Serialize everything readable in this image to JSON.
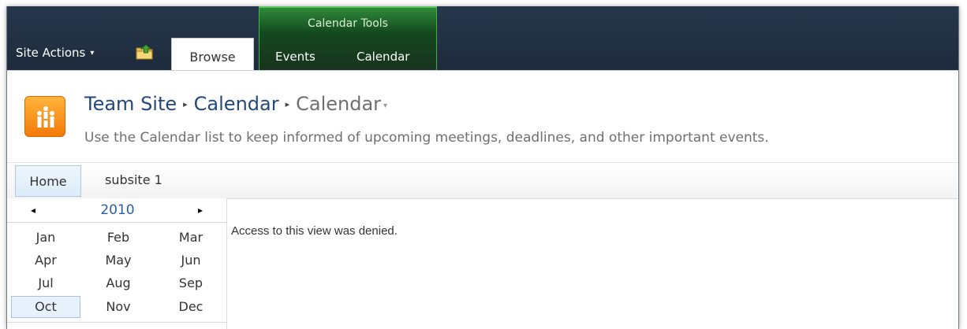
{
  "ribbon": {
    "site_actions_label": "Site Actions",
    "site_actions_arrow": "▾",
    "browse_tab": "Browse",
    "context_group_title": "Calendar Tools",
    "events_tab": "Events",
    "calendar_tab": "Calendar"
  },
  "title_area": {
    "site_name": "Team Site",
    "list_name": "Calendar",
    "view_name": "Calendar",
    "separator": "▸",
    "view_drop": "▾",
    "description": "Use the Calendar list to keep informed of upcoming meetings, deadlines, and other important events."
  },
  "top_nav": {
    "items": [
      {
        "label": "Home",
        "selected": true
      },
      {
        "label": "subsite 1",
        "selected": false
      }
    ]
  },
  "date_picker": {
    "prev": "◂",
    "next": "▸",
    "year": "2010",
    "months": [
      "Jan",
      "Feb",
      "Mar",
      "Apr",
      "May",
      "Jun",
      "Jul",
      "Aug",
      "Sep",
      "Oct",
      "Nov",
      "Dec"
    ],
    "selected_month": "Oct"
  },
  "main": {
    "message": "Access to this view was denied."
  },
  "colors": {
    "ribbon_bg": "#1f2e40",
    "context_tab_green": "#1e5f28",
    "link_blue": "#23487a",
    "selected_bg": "#e6f1fb"
  }
}
